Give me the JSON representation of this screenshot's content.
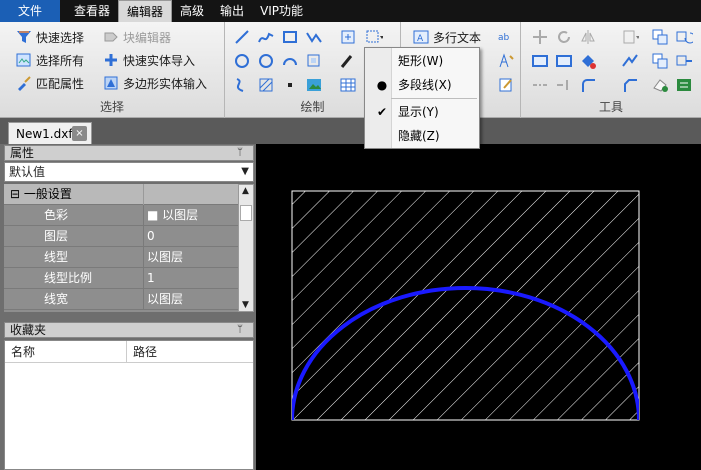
{
  "menu": {
    "file": "文件",
    "tabs": [
      "查看器",
      "编辑器",
      "高级",
      "输出",
      "VIP功能"
    ]
  },
  "ribbon": {
    "select_group": {
      "label": "选择",
      "quick_select": "快速选择",
      "select_all": "选择所有",
      "match_props": "匹配属性",
      "block_editor": "块编辑器",
      "quick_import": "快速实体导入",
      "polygon_input": "多边形实体输入"
    },
    "draw_group": {
      "label": "绘制"
    },
    "text_group": {
      "multiline_text": "多行文本"
    },
    "tools_group": {
      "label": "工具"
    }
  },
  "doc_tab": {
    "name": "New1.dxf",
    "close": "×"
  },
  "properties_panel": {
    "title": "属性",
    "pin": "ᛘ",
    "selector_value": "默认值",
    "section": "⊟ 一般设置",
    "rows": [
      {
        "name": "色彩",
        "value": "■ 以图层"
      },
      {
        "name": "图层",
        "value": "0"
      },
      {
        "name": "线型",
        "value": "以图层"
      },
      {
        "name": "线型比例",
        "value": "1"
      },
      {
        "name": "线宽",
        "value": "以图层"
      }
    ]
  },
  "favorites_panel": {
    "title": "收藏夹",
    "col_name": "名称",
    "col_path": "路径"
  },
  "dropdown": {
    "items": [
      {
        "label": "矩形(W)",
        "mark": ""
      },
      {
        "label": "多段线(X)",
        "mark": "●"
      },
      {
        "label": "显示(Y)",
        "mark": "✔"
      },
      {
        "label": "隐藏(Z)",
        "mark": ""
      }
    ]
  },
  "colors": {
    "arc": "#1a1aff",
    "hatch": "#ffffff",
    "file_tab": "#1b5fb5",
    "canvas_bg": "#000000"
  }
}
